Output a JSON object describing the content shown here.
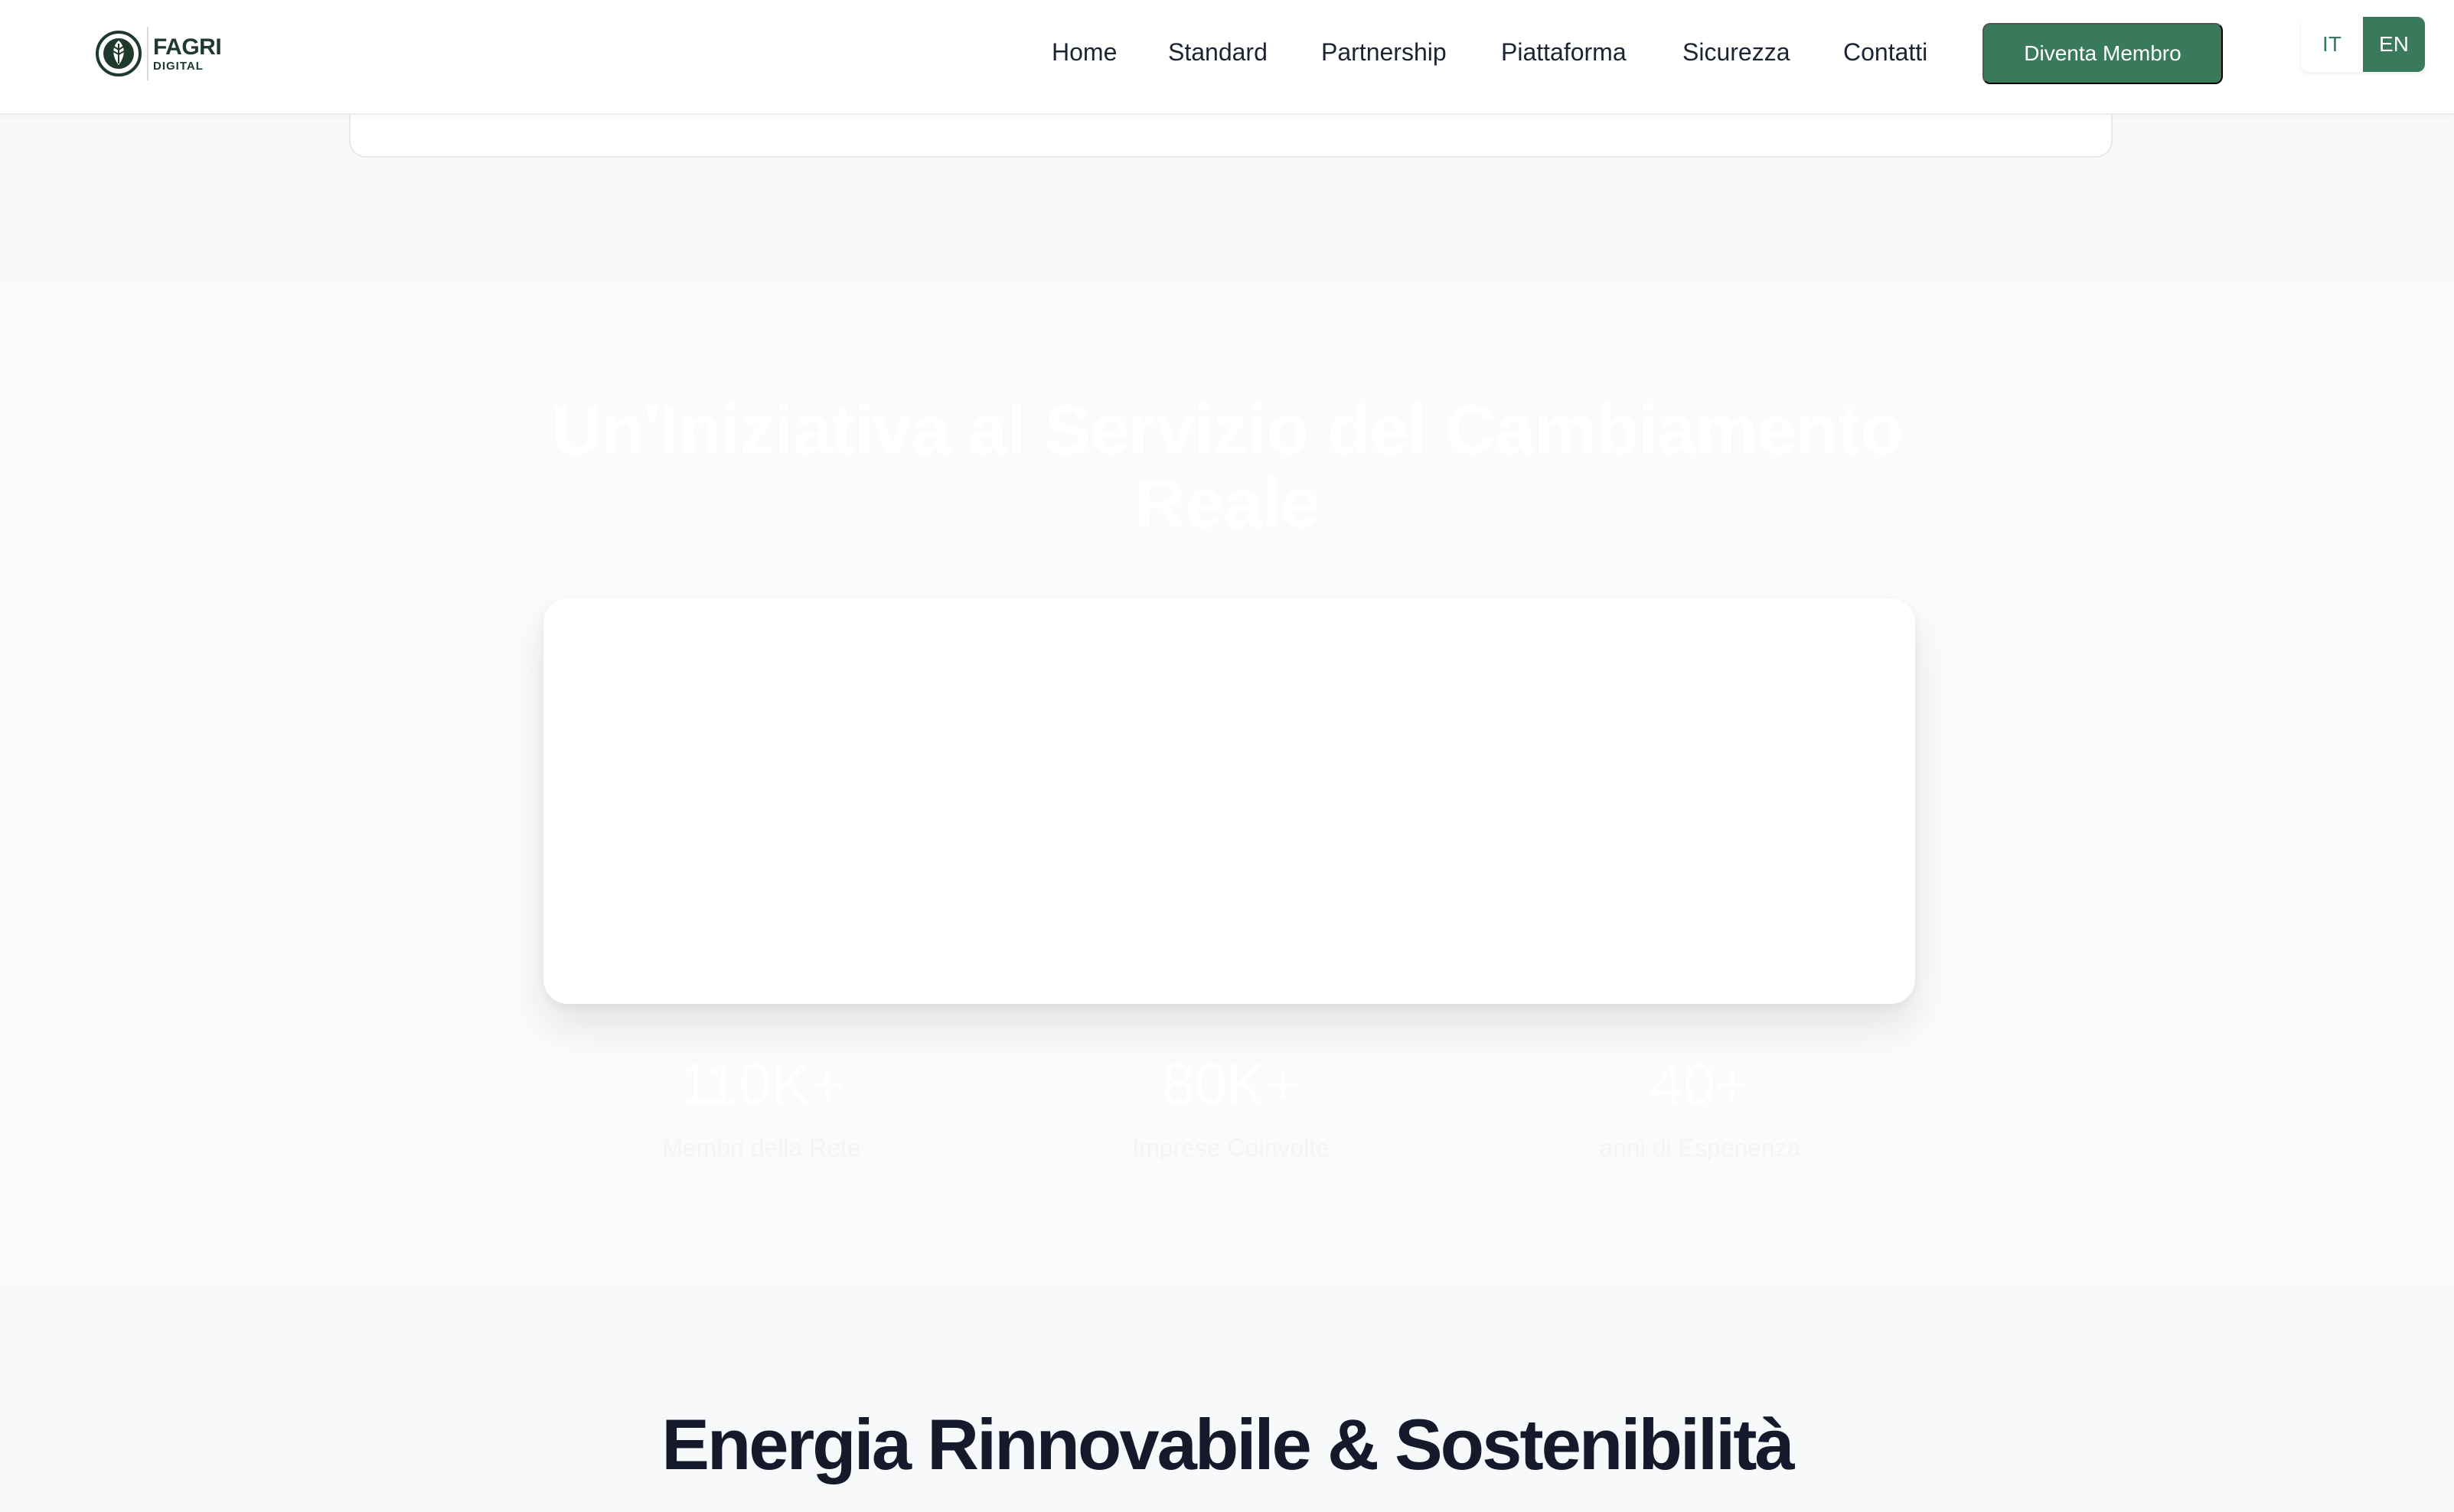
{
  "header": {
    "logo": {
      "line1": "FAGRI",
      "line2": "DIGITAL"
    },
    "nav": [
      {
        "label": "Home"
      },
      {
        "label": "Standard"
      },
      {
        "label": "Partnership"
      },
      {
        "label": "Piattaforma"
      },
      {
        "label": "Sicurezza"
      },
      {
        "label": "Contatti"
      }
    ],
    "cta_label": "Diventa Membro",
    "languages": {
      "it": "IT",
      "en": "EN",
      "active": "EN"
    }
  },
  "initiative": {
    "title": "Un'Iniziativa al Servizio del Cambiamento Reale",
    "stats": [
      {
        "value": "110K+",
        "label": "Membri della Rete"
      },
      {
        "value": "80K+",
        "label": "Imprese Coinvolte"
      },
      {
        "value": "40+",
        "label": "anni di Esperienza"
      }
    ]
  },
  "renewable": {
    "title": "Energia Rinnovabile & Sostenibilità"
  },
  "colors": {
    "brand_green": "#3a7a5c",
    "text_dark": "#1c2433",
    "page_bg": "#f8f9fb"
  }
}
